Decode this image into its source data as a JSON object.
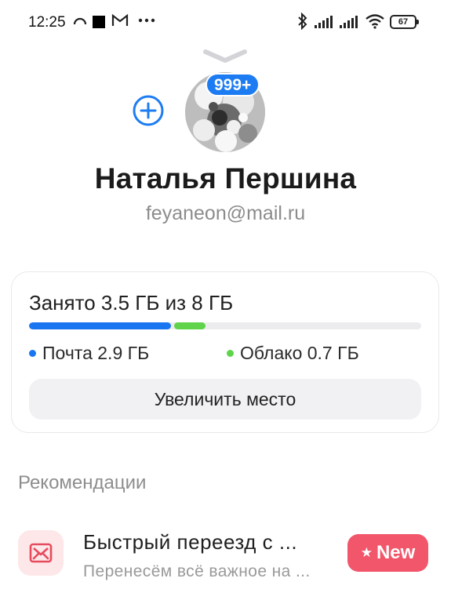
{
  "status_bar": {
    "time": "12:25",
    "battery_level": "67",
    "icons": [
      "hotspot-icon",
      "square-notification-icon",
      "gmail-icon",
      "more-dots-icon",
      "bluetooth-icon",
      "signal-icon",
      "signal-icon",
      "wifi-icon",
      "battery-icon"
    ]
  },
  "profile": {
    "unread_badge": "999+",
    "name": "Наталья Першина",
    "email": "feyaneon@mail.ru",
    "add_account_icon": "plus-circle-icon"
  },
  "storage": {
    "title": "Занято 3.5 ГБ из 8 ГБ",
    "used_fraction": 0.4375,
    "total_gb": 8,
    "mail_gb": 2.9,
    "cloud_gb": 0.7,
    "mail_label": "Почта 2.9 ГБ",
    "cloud_label": "Облако 0.7 ГБ",
    "upgrade_label": "Увеличить место",
    "colors": {
      "mail": "#1a76f0",
      "cloud": "#5fd44a"
    }
  },
  "recommendations": {
    "section_title": "Рекомендации",
    "items": [
      {
        "icon": "mail-move-icon",
        "title": "Быстрый переезд с ...",
        "subtitle": "Перенесём всё важное на ...",
        "badge": "New"
      }
    ]
  }
}
